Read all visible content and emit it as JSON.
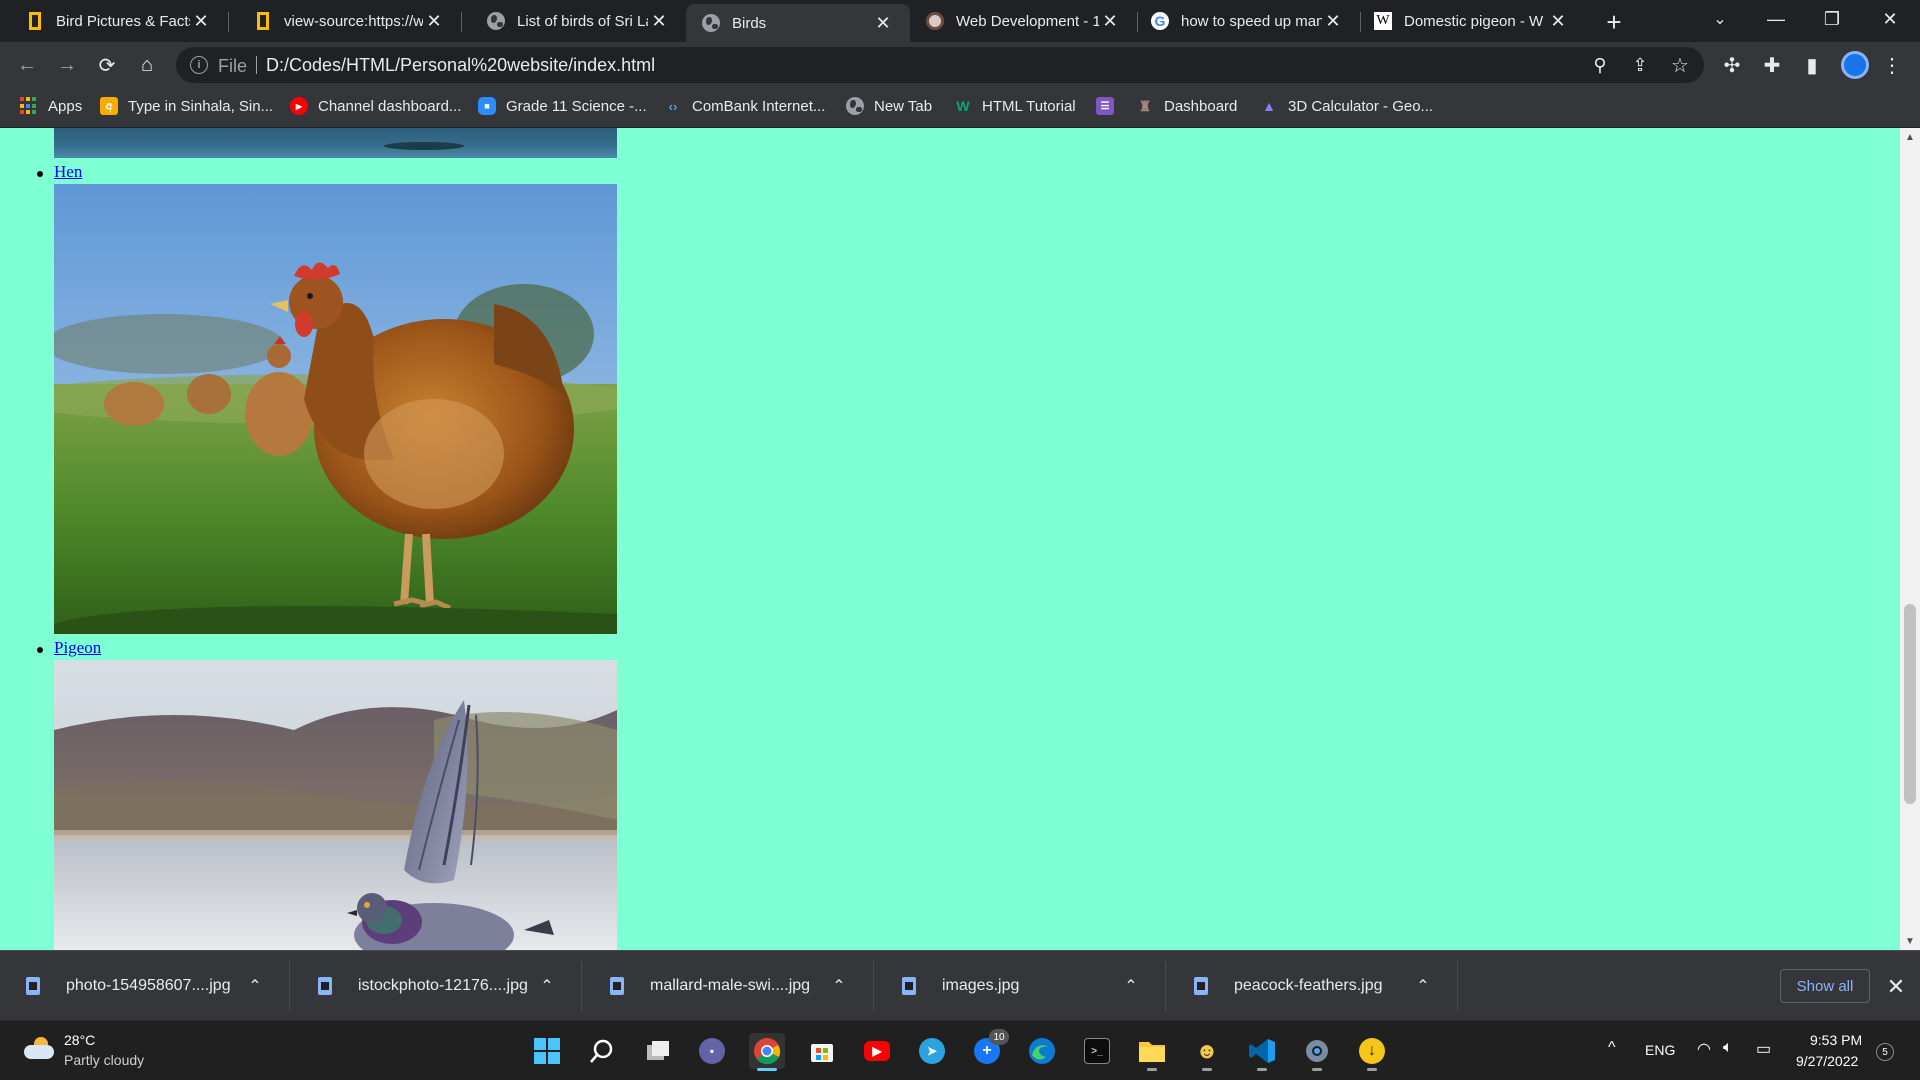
{
  "browser": {
    "tabs": [
      {
        "title": "Bird Pictures & Facts",
        "icon": "natgeo-icon",
        "active": false
      },
      {
        "title": "view-source:https://w",
        "icon": "natgeo-icon",
        "active": false
      },
      {
        "title": "List of birds of Sri Lan",
        "icon": "globe-icon",
        "active": false
      },
      {
        "title": "Birds",
        "icon": "globe-icon",
        "active": true
      },
      {
        "title": "Web Development - 1",
        "icon": "web-dev-icon",
        "active": false
      },
      {
        "title": "how to speed up man",
        "icon": "google-icon",
        "active": false
      },
      {
        "title": "Domestic pigeon - W",
        "icon": "wikipedia-icon",
        "active": false
      }
    ],
    "new_tab_label": "+",
    "close_glyph": "✕",
    "window_controls": {
      "tab_search": "⌄",
      "minimize": "—",
      "restore": "❐",
      "close": "✕"
    },
    "toolbar": {
      "back": "←",
      "forward": "→",
      "reload": "⟳",
      "home": "⌂",
      "omnibox_scheme": "File",
      "omnibox_url": "D:/Codes/HTML/Personal%20website/index.html",
      "zoom": "⚲",
      "share": "⇪",
      "bookmark": "☆",
      "extension": "✣",
      "puzzle": "✚",
      "sidepanel": "▮",
      "menu": "⋮"
    },
    "bookmarks": [
      {
        "label": "Apps",
        "icon": "apps-icon",
        "color": "#ea4335"
      },
      {
        "label": "Type in Sinhala, Sin...",
        "icon": "sinhala-icon",
        "color": "#f9ab00"
      },
      {
        "label": "Channel dashboard...",
        "icon": "youtube-icon",
        "color": "#ff0000"
      },
      {
        "label": "Grade 11 Science -...",
        "icon": "zoom-icon",
        "color": "#2d8cff"
      },
      {
        "label": "ComBank Internet...",
        "icon": "combank-icon",
        "color": "#1f6fb5"
      },
      {
        "label": "New Tab",
        "icon": "globe-icon",
        "color": "#9aa0a6"
      },
      {
        "label": "HTML Tutorial",
        "icon": "w3schools-icon",
        "color": "#04aa6d"
      },
      {
        "label": "",
        "icon": "list-icon",
        "color": "#7e57c2"
      },
      {
        "label": "Dashboard",
        "icon": "dashboard-icon",
        "color": "#8d6e63"
      },
      {
        "label": "3D Calculator - Geo...",
        "icon": "geogebra-icon",
        "color": "#6557d2"
      }
    ]
  },
  "page": {
    "background": "#7fffd4",
    "items": [
      {
        "label": "Hen",
        "image": "hen-photo"
      },
      {
        "label": "Pigeon",
        "image": "pigeon-photo"
      }
    ]
  },
  "downloads": {
    "files": [
      "photo-154958607....jpg",
      "istockphoto-12176....jpg",
      "mallard-male-swi....jpg",
      "images.jpg",
      "peacock-feathers.jpg"
    ],
    "chevron": "⌃",
    "show_all": "Show all",
    "close": "✕"
  },
  "taskbar": {
    "weather": {
      "temp": "28°C",
      "desc": "Partly cloudy"
    },
    "apps": [
      "start-icon",
      "search-icon",
      "task-view-icon",
      "teams-chat-icon",
      "chrome-icon",
      "store-icon",
      "youtube-icon",
      "telegram-icon",
      "messenger-icon",
      "edge-icon",
      "terminal-icon",
      "file-explorer-icon",
      "pokemon-icon",
      "vscode-icon",
      "settings-icon",
      "download-icon"
    ],
    "messenger_badge": "10",
    "tray": {
      "chevron": "^",
      "lang": "ENG",
      "time": "9:53 PM",
      "date": "9/27/2022",
      "notif_count": "5"
    }
  }
}
